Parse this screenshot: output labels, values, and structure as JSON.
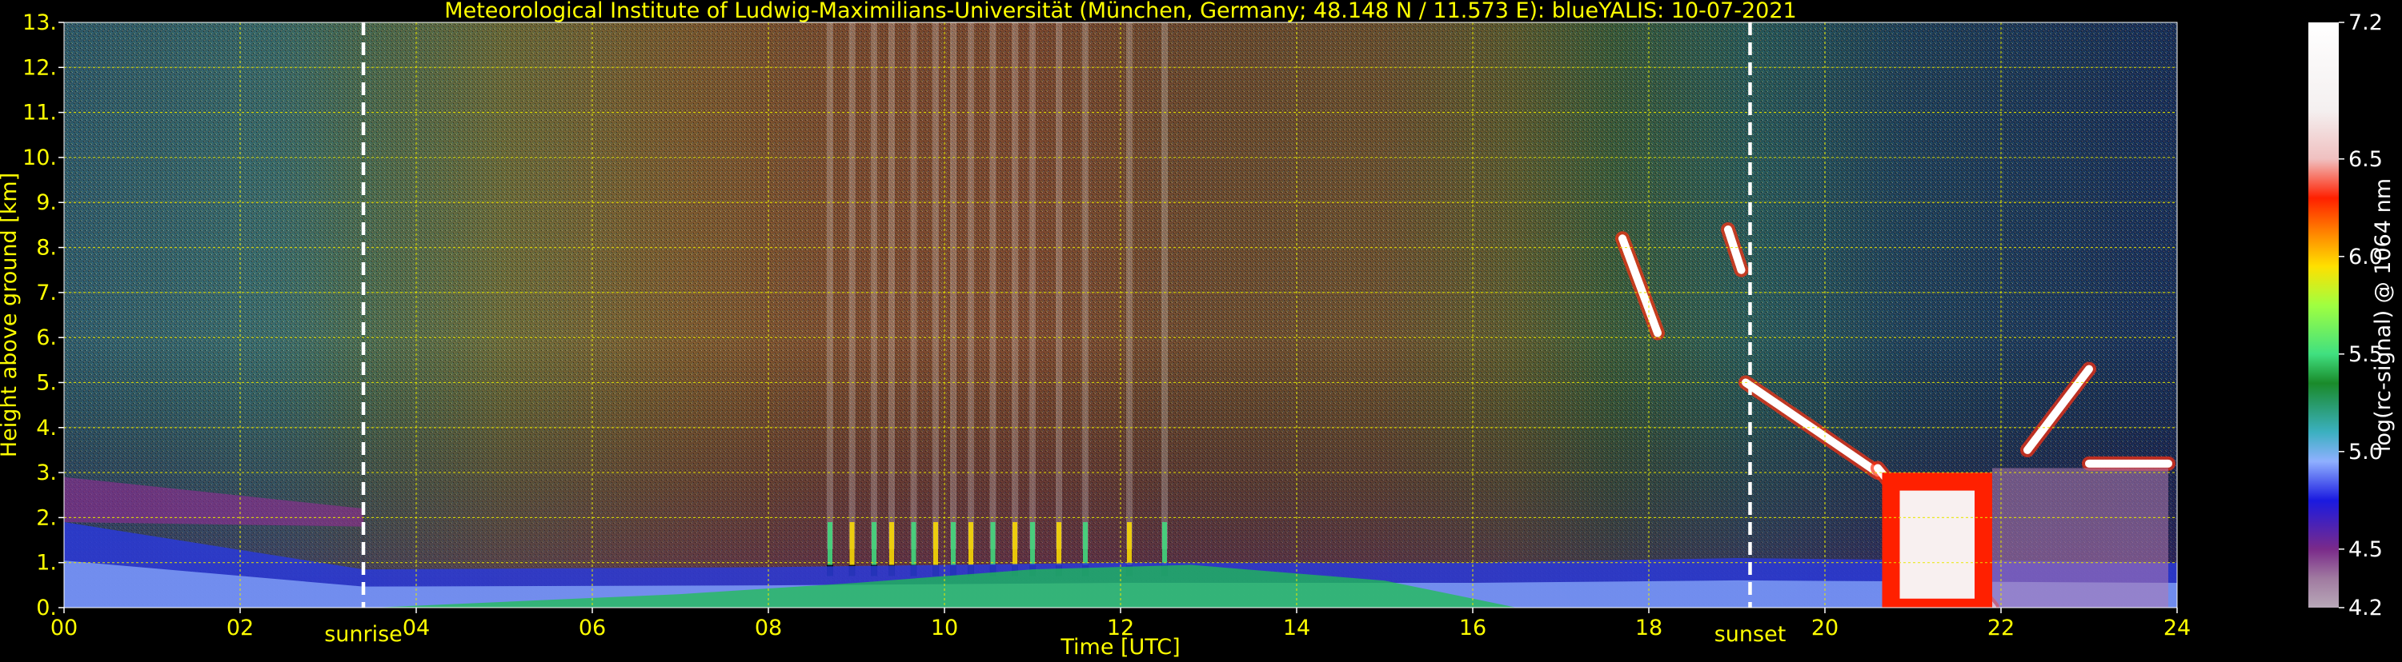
{
  "chart_data": {
    "type": "heatmap",
    "title": "Meteorological Institute of Ludwig-Maximilians-Universität (München, Germany; 48.148 N / 11.573 E):     blueYALIS: 10-07-2021",
    "xlabel": "Time [UTC]",
    "ylabel": "Height above ground [km]",
    "xlim": [
      0,
      24
    ],
    "ylim": [
      0,
      13
    ],
    "xticks": [
      0,
      2,
      4,
      6,
      8,
      10,
      12,
      14,
      16,
      18,
      20,
      22,
      24
    ],
    "xticklabels": [
      "00",
      "02",
      "04",
      "06",
      "08",
      "10",
      "12",
      "14",
      "16",
      "18",
      "20",
      "22",
      "24"
    ],
    "yticks": [
      0,
      1,
      2,
      3,
      4,
      5,
      6,
      7,
      8,
      9,
      10,
      11,
      12,
      13
    ],
    "yticklabels": [
      "0.",
      "1.",
      "2.",
      "3.",
      "4.",
      "5.",
      "6.",
      "7.",
      "8.",
      "9.",
      "10.",
      "11.",
      "12.",
      "13."
    ],
    "grid": true,
    "colorbar": {
      "label": "log(rc-signal) @ 1064 nm",
      "range": [
        4.2,
        7.2
      ],
      "ticks": [
        7.2,
        6.5,
        6.0,
        5.5,
        5.0,
        4.5,
        4.2
      ],
      "ticklabels": [
        "7.2",
        "6.5",
        "6.0",
        "5.5",
        "5.0",
        "4.5",
        "4.2"
      ],
      "colors": [
        {
          "v": 4.2,
          "c": "#b8a8b8"
        },
        {
          "v": 4.35,
          "c": "#a07aa0"
        },
        {
          "v": 4.5,
          "c": "#7a2a8a"
        },
        {
          "v": 4.75,
          "c": "#1a1ae0"
        },
        {
          "v": 4.95,
          "c": "#8fb0ff"
        },
        {
          "v": 5.1,
          "c": "#3bb0c0"
        },
        {
          "v": 5.35,
          "c": "#1a8a2a"
        },
        {
          "v": 5.5,
          "c": "#40e080"
        },
        {
          "v": 5.75,
          "c": "#a0ff40"
        },
        {
          "v": 5.95,
          "c": "#ffe000"
        },
        {
          "v": 6.1,
          "c": "#ff9000"
        },
        {
          "v": 6.3,
          "c": "#ff2000"
        },
        {
          "v": 6.5,
          "c": "#f0c0c0"
        },
        {
          "v": 6.75,
          "c": "#f4f0f0"
        },
        {
          "v": 7.2,
          "c": "#ffffff"
        }
      ]
    },
    "annotations": [
      {
        "text": "sunrise",
        "x": 3.4
      },
      {
        "text": "sunset",
        "x": 19.15
      }
    ],
    "field": {
      "background_by_time": [
        {
          "t": 0,
          "c": "#2f5a6a"
        },
        {
          "t": 2.4,
          "c": "#3a6a6a"
        },
        {
          "t": 3.4,
          "c": "#4a6a50"
        },
        {
          "t": 5,
          "c": "#6a6a3a"
        },
        {
          "t": 7,
          "c": "#7a5a30"
        },
        {
          "t": 9,
          "c": "#7a4a30"
        },
        {
          "t": 11,
          "c": "#7a4830"
        },
        {
          "t": 13,
          "c": "#6a4a30"
        },
        {
          "t": 15,
          "c": "#6a5030"
        },
        {
          "t": 16.5,
          "c": "#5a5a30"
        },
        {
          "t": 17.6,
          "c": "#3a5a3a"
        },
        {
          "t": 19.15,
          "c": "#2a5a5a"
        },
        {
          "t": 21,
          "c": "#20405a"
        },
        {
          "t": 24,
          "c": "#1a305a"
        }
      ],
      "boundary_layer_top_km": [
        {
          "t": 0,
          "h": 1.9
        },
        {
          "t": 3.4,
          "h": 0.85
        },
        {
          "t": 8,
          "h": 0.9
        },
        {
          "t": 12,
          "h": 1.0
        },
        {
          "t": 16,
          "h": 1.0
        },
        {
          "t": 19,
          "h": 1.1
        },
        {
          "t": 24,
          "h": 1.0
        }
      ],
      "cloud_layers": [
        {
          "t0": 19.1,
          "t1": 20.6,
          "h0": 5.0,
          "h1": 3.0
        },
        {
          "t0": 20.6,
          "t1": 21.9,
          "h0": 3.1,
          "h1": 0.0
        },
        {
          "t0": 22.3,
          "t1": 23.0,
          "h0": 3.5,
          "h1": 5.3
        },
        {
          "t0": 23.0,
          "t1": 23.9,
          "h0": 3.2,
          "h1": 3.2
        },
        {
          "t0": 17.7,
          "t1": 18.1,
          "h0": 8.2,
          "h1": 6.1
        },
        {
          "t0": 18.9,
          "t1": 19.05,
          "h0": 8.4,
          "h1": 7.5
        }
      ],
      "precip_streaks_hours": [
        8.7,
        8.95,
        9.2,
        9.4,
        9.65,
        9.9,
        10.1,
        10.3,
        10.55,
        10.8,
        11.0,
        11.3,
        11.6,
        12.1,
        12.5
      ]
    }
  }
}
